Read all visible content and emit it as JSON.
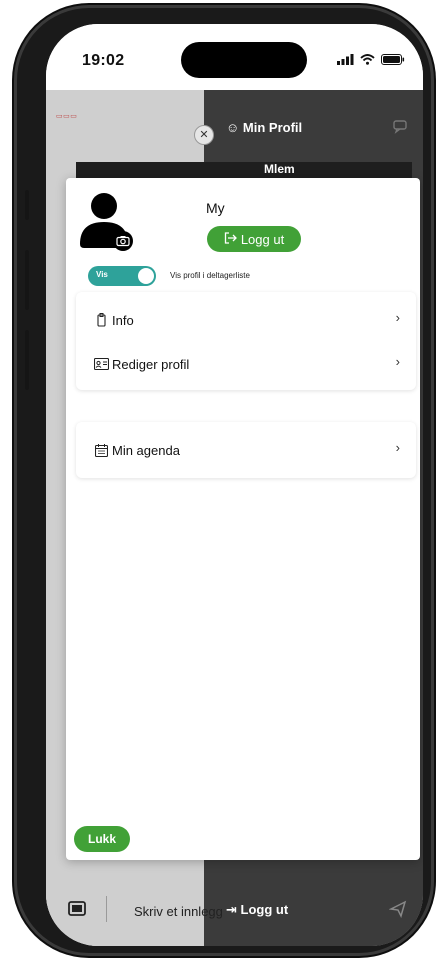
{
  "status_bar": {
    "time": "19:02"
  },
  "background": {
    "profile_title": "Min Profil",
    "strip_text": "Mlem",
    "bottom": {
      "write_placeholder": "Skriv et innlegg",
      "logout": "Logg ut"
    }
  },
  "modal": {
    "user_name": "My",
    "logout_label": "Logg ut",
    "visibility_toggle": {
      "label": "Vis",
      "description": "Vis profil i deltagerliste",
      "on": true
    },
    "menu": [
      {
        "label": "Info",
        "icon": "badge-icon"
      },
      {
        "label": "Rediger profil",
        "icon": "id-card-icon"
      }
    ],
    "agenda": {
      "label": "Min agenda",
      "icon": "calendar-icon"
    },
    "close_label": "Lukk"
  },
  "colors": {
    "accent_green": "#41a137",
    "toggle_teal": "#2ea29a",
    "dark_panel": "#3b3b3b"
  }
}
